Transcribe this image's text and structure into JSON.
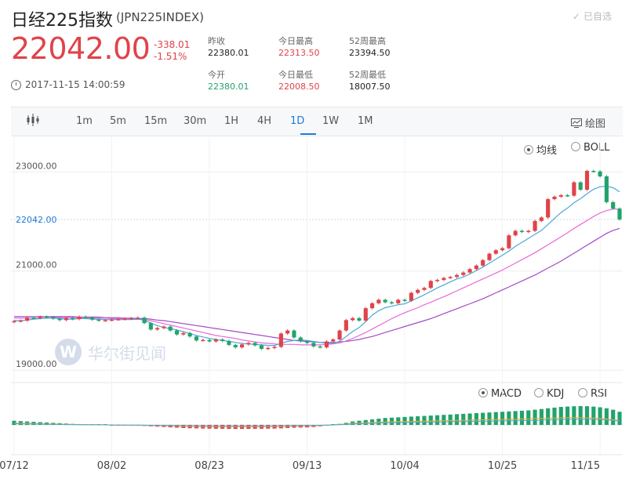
{
  "header": {
    "title": "日经225指数",
    "code": "(JPN225INDEX)",
    "favorite": "已自选",
    "price": "22042.00",
    "change": "-338.01",
    "change_pct": "-1.51%",
    "timestamp": "2017-11-15 14:00:59"
  },
  "stats": [
    {
      "label": "昨收",
      "value": "22380.01",
      "color": "#222222"
    },
    {
      "label": "今日最高",
      "value": "22313.50",
      "color": "#e0434a"
    },
    {
      "label": "52周最高",
      "value": "23394.50",
      "color": "#222222"
    },
    {
      "label": "今开",
      "value": "22380.01",
      "color": "#22a36b"
    },
    {
      "label": "今日最低",
      "value": "22008.50",
      "color": "#e0434a"
    },
    {
      "label": "52周最低",
      "value": "18007.50",
      "color": "#222222"
    }
  ],
  "toolbar": {
    "intervals": [
      "1m",
      "5m",
      "15m",
      "30m",
      "1H",
      "4H",
      "1D",
      "1W",
      "1M"
    ],
    "active": "1D",
    "draw_label": "绘图"
  },
  "main_chart": {
    "options": [
      {
        "label": "均线",
        "on": true
      },
      {
        "label": "BOLL",
        "on": false
      }
    ],
    "current_price_label": "22042.00",
    "watermark": "华尔街见闻"
  },
  "sub_chart": {
    "options": [
      {
        "label": "MACD",
        "on": true
      },
      {
        "label": "KDJ",
        "on": false
      },
      {
        "label": "RSI",
        "on": false
      }
    ]
  },
  "colors": {
    "up": "#e0434a",
    "down": "#22a36b",
    "ma_blue": "#4aa8d8",
    "ma_pink": "#e86ad6",
    "ma_purple": "#a24ac8",
    "accent": "#1e7bd6"
  },
  "chart_data": {
    "type": "candlestick",
    "y_ticks": [
      "23000.00",
      "21000.00",
      "19000.00"
    ],
    "y_tick_values": [
      23000,
      21000,
      19000
    ],
    "ylim": [
      18750,
      23700
    ],
    "x_ticks": [
      "07/12",
      "08/02",
      "08/23",
      "09/13",
      "10/04",
      "10/25",
      "11/15"
    ],
    "x_tick_index": [
      0,
      15,
      30,
      45,
      60,
      75,
      90
    ],
    "close": [
      19990,
      20000,
      20060,
      20050,
      20080,
      20070,
      20040,
      20010,
      20050,
      20030,
      20080,
      20060,
      20020,
      20000,
      20010,
      20020,
      20030,
      20040,
      20050,
      20060,
      19950,
      19820,
      19850,
      19880,
      19800,
      19720,
      19750,
      19680,
      19600,
      19610,
      19580,
      19620,
      19590,
      19510,
      19460,
      19520,
      19550,
      19500,
      19430,
      19450,
      19470,
      19740,
      19800,
      19660,
      19580,
      19550,
      19480,
      19460,
      19580,
      19620,
      19800,
      20010,
      20050,
      20000,
      20250,
      20350,
      20420,
      20370,
      20350,
      20420,
      20400,
      20560,
      20620,
      20660,
      20800,
      20820,
      20860,
      20880,
      20920,
      20970,
      21040,
      21110,
      21220,
      21350,
      21420,
      21460,
      21720,
      21810,
      21790,
      21810,
      22010,
      22080,
      22450,
      22500,
      22530,
      22520,
      22790,
      22640,
      23020,
      23010,
      22910,
      22390,
      22260,
      22040
    ],
    "ma_blue": [
      20000,
      20000,
      20010,
      20030,
      20040,
      20050,
      20050,
      20040,
      20030,
      20030,
      20040,
      20040,
      20030,
      20030,
      20020,
      20020,
      20020,
      20020,
      20020,
      20030,
      20010,
      19950,
      19900,
      19860,
      19840,
      19810,
      19780,
      19740,
      19700,
      19670,
      19640,
      19620,
      19600,
      19580,
      19560,
      19540,
      19530,
      19520,
      19510,
      19500,
      19500,
      19540,
      19580,
      19600,
      19610,
      19600,
      19580,
      19560,
      19540,
      19540,
      19580,
      19680,
      19780,
      19860,
      19980,
      20110,
      20200,
      20260,
      20290,
      20320,
      20340,
      20400,
      20460,
      20520,
      20590,
      20660,
      20720,
      20780,
      20840,
      20880,
      20940,
      21010,
      21080,
      21160,
      21240,
      21320,
      21400,
      21500,
      21580,
      21660,
      21740,
      21820,
      21940,
      22060,
      22180,
      22270,
      22380,
      22460,
      22560,
      22650,
      22700,
      22710,
      22680,
      22600
    ],
    "ma_pink": [
      20050,
      20050,
      20050,
      20050,
      20050,
      20050,
      20060,
      20060,
      20060,
      20060,
      20060,
      20060,
      20050,
      20050,
      20050,
      20040,
      20040,
      20040,
      20030,
      20030,
      20020,
      20000,
      19970,
      19940,
      19910,
      19880,
      19850,
      19820,
      19790,
      19760,
      19730,
      19700,
      19680,
      19660,
      19640,
      19610,
      19590,
      19570,
      19550,
      19540,
      19530,
      19520,
      19520,
      19520,
      19510,
      19510,
      19510,
      19510,
      19520,
      19530,
      19550,
      19590,
      19640,
      19700,
      19760,
      19830,
      19900,
      19970,
      20040,
      20100,
      20160,
      20210,
      20260,
      20320,
      20370,
      20430,
      20480,
      20540,
      20600,
      20660,
      20720,
      20780,
      20840,
      20900,
      20960,
      21020,
      21090,
      21160,
      21230,
      21300,
      21370,
      21450,
      21530,
      21610,
      21690,
      21770,
      21860,
      21940,
      22020,
      22100,
      22170,
      22220,
      22250,
      22250
    ],
    "ma_purple": [
      20080,
      20080,
      20080,
      20080,
      20080,
      20080,
      20080,
      20080,
      20080,
      20080,
      20070,
      20070,
      20070,
      20070,
      20060,
      20060,
      20060,
      20050,
      20050,
      20040,
      20040,
      20030,
      20010,
      20000,
      19980,
      19960,
      19940,
      19920,
      19900,
      19880,
      19860,
      19840,
      19820,
      19800,
      19780,
      19760,
      19740,
      19720,
      19700,
      19680,
      19660,
      19640,
      19620,
      19600,
      19590,
      19580,
      19570,
      19560,
      19560,
      19560,
      19570,
      19580,
      19600,
      19620,
      19650,
      19680,
      19720,
      19760,
      19800,
      19840,
      19880,
      19920,
      19960,
      20000,
      20040,
      20090,
      20140,
      20190,
      20240,
      20290,
      20340,
      20390,
      20440,
      20500,
      20560,
      20620,
      20680,
      20740,
      20800,
      20860,
      20920,
      20990,
      21060,
      21130,
      21200,
      21280,
      21360,
      21440,
      21520,
      21600,
      21680,
      21760,
      21820,
      21860
    ],
    "macd_hist": [
      60,
      55,
      50,
      45,
      40,
      35,
      30,
      25,
      20,
      15,
      12,
      10,
      8,
      5,
      2,
      -2,
      -5,
      -8,
      -10,
      -12,
      -15,
      -20,
      -25,
      -30,
      -35,
      -40,
      -45,
      -48,
      -50,
      -52,
      -54,
      -55,
      -56,
      -57,
      -58,
      -58,
      -57,
      -56,
      -55,
      -54,
      -53,
      -50,
      -45,
      -40,
      -38,
      -36,
      -30,
      -20,
      -10,
      0,
      15,
      30,
      50,
      60,
      70,
      80,
      90,
      100,
      105,
      110,
      115,
      120,
      125,
      130,
      135,
      140,
      145,
      150,
      155,
      160,
      165,
      170,
      175,
      180,
      185,
      190,
      195,
      200,
      205,
      210,
      220,
      230,
      240,
      250,
      260,
      265,
      270,
      272,
      270,
      265,
      255,
      240,
      220,
      190
    ]
  }
}
